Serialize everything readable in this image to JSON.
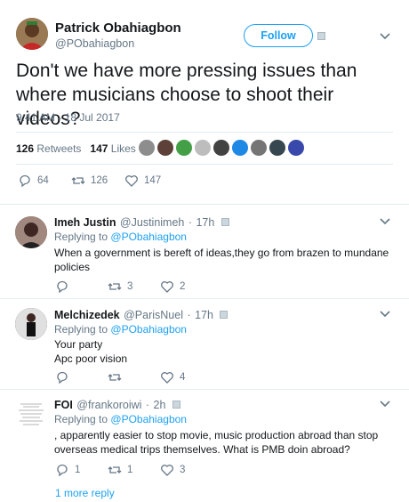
{
  "tweet": {
    "author_name": "Patrick Obahiagbon",
    "author_handle": "@PObahiagbon",
    "follow_label": "Follow",
    "text": "Don't we have more pressing issues than where musicians choose to shoot their videos?",
    "timestamp": "9:41 AM - 18 Jul 2017",
    "retweets_count": "126",
    "retweets_label": "Retweets",
    "likes_count": "147",
    "likes_label": "Likes",
    "actions": {
      "replies": "64",
      "retweets": "126",
      "likes": "147"
    }
  },
  "replies": [
    {
      "name": "Imeh Justin",
      "handle": "@Justinimeh",
      "time": "17h",
      "replying_prefix": "Replying to",
      "replying_to": "@PObahiagbon",
      "text": "When a government is bereft of ideas,they go from brazen to mundane policies",
      "retweets": "3",
      "likes": "2"
    },
    {
      "name": "Melchizedek",
      "handle": "@ParisNuel",
      "time": "17h",
      "replying_prefix": "Replying to",
      "replying_to": "@PObahiagbon",
      "text_line1": "Your party",
      "text_line2": "Apc poor vision",
      "likes": "4"
    },
    {
      "name": "FOI",
      "handle": "@frankoroiwi",
      "time": "2h",
      "replying_prefix": "Replying to",
      "replying_to": "@PObahiagbon",
      "text": ", apparently easier to stop movie, music production abroad than stop overseas medical trips themselves. What is PMB doin abroad?",
      "replies": "1",
      "retweets": "1",
      "likes": "3"
    }
  ],
  "more_reply_label": "1 more reply",
  "separator": "·",
  "colors": {
    "accent": "#1da1f2",
    "muted": "#657786",
    "text": "#14171a",
    "divider": "#e6ecf0"
  },
  "icons": [
    "reply-icon",
    "retweet-icon",
    "like-icon",
    "chevron-down-icon",
    "dm-icon"
  ]
}
